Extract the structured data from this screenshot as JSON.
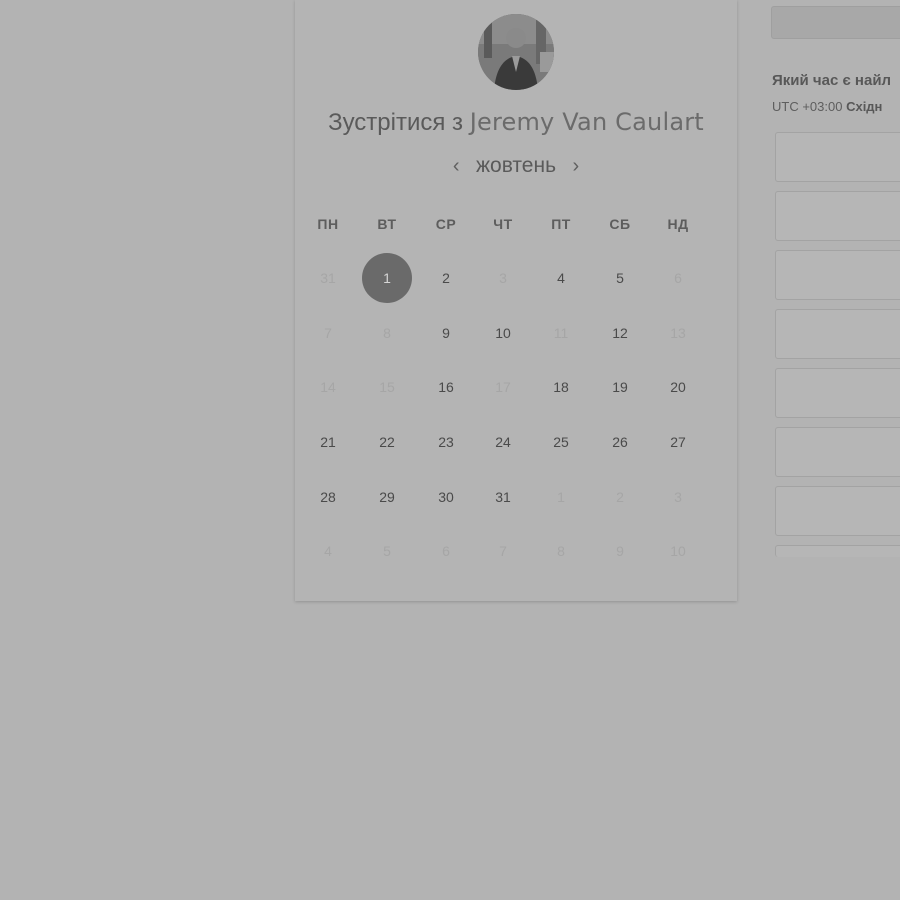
{
  "header": {
    "title_prefix": "Зустрітися з",
    "host_name": "Jeremy Van Caulart"
  },
  "calendar": {
    "month": "жовтень",
    "prev_label": "‹",
    "next_label": "›",
    "weekdays": [
      "ПН",
      "ВТ",
      "СР",
      "ЧТ",
      "ПТ",
      "СБ",
      "НД"
    ],
    "weeks": [
      [
        {
          "d": "31",
          "s": "muted"
        },
        {
          "d": "1",
          "s": "selected"
        },
        {
          "d": "2",
          "s": "active"
        },
        {
          "d": "3",
          "s": "muted"
        },
        {
          "d": "4",
          "s": "active"
        },
        {
          "d": "5",
          "s": "active"
        },
        {
          "d": "6",
          "s": "muted"
        }
      ],
      [
        {
          "d": "7",
          "s": "muted"
        },
        {
          "d": "8",
          "s": "muted"
        },
        {
          "d": "9",
          "s": "active"
        },
        {
          "d": "10",
          "s": "active"
        },
        {
          "d": "11",
          "s": "muted"
        },
        {
          "d": "12",
          "s": "active"
        },
        {
          "d": "13",
          "s": "muted"
        }
      ],
      [
        {
          "d": "14",
          "s": "muted"
        },
        {
          "d": "15",
          "s": "muted"
        },
        {
          "d": "16",
          "s": "active"
        },
        {
          "d": "17",
          "s": "muted"
        },
        {
          "d": "18",
          "s": "active"
        },
        {
          "d": "19",
          "s": "active"
        },
        {
          "d": "20",
          "s": "active"
        }
      ],
      [
        {
          "d": "21",
          "s": "active"
        },
        {
          "d": "22",
          "s": "active"
        },
        {
          "d": "23",
          "s": "active"
        },
        {
          "d": "24",
          "s": "active"
        },
        {
          "d": "25",
          "s": "active"
        },
        {
          "d": "26",
          "s": "active"
        },
        {
          "d": "27",
          "s": "active"
        }
      ],
      [
        {
          "d": "28",
          "s": "active"
        },
        {
          "d": "29",
          "s": "active"
        },
        {
          "d": "30",
          "s": "active"
        },
        {
          "d": "31",
          "s": "active"
        },
        {
          "d": "1",
          "s": "muted"
        },
        {
          "d": "2",
          "s": "muted"
        },
        {
          "d": "3",
          "s": "muted"
        }
      ],
      [
        {
          "d": "4",
          "s": "muted"
        },
        {
          "d": "5",
          "s": "muted"
        },
        {
          "d": "6",
          "s": "muted"
        },
        {
          "d": "7",
          "s": "muted"
        },
        {
          "d": "8",
          "s": "muted"
        },
        {
          "d": "9",
          "s": "muted"
        },
        {
          "d": "10",
          "s": "muted"
        }
      ]
    ]
  },
  "times": {
    "question": "Який час є найл",
    "timezone_offset": "UTC +03:00",
    "timezone_name": "Східн",
    "slot_count": 8
  },
  "colors": {
    "overlay": "#b3b3b3",
    "selected_day": "#6a6a6a"
  },
  "icons": {
    "prev": "chevron-left-icon",
    "next": "chevron-right-icon"
  }
}
